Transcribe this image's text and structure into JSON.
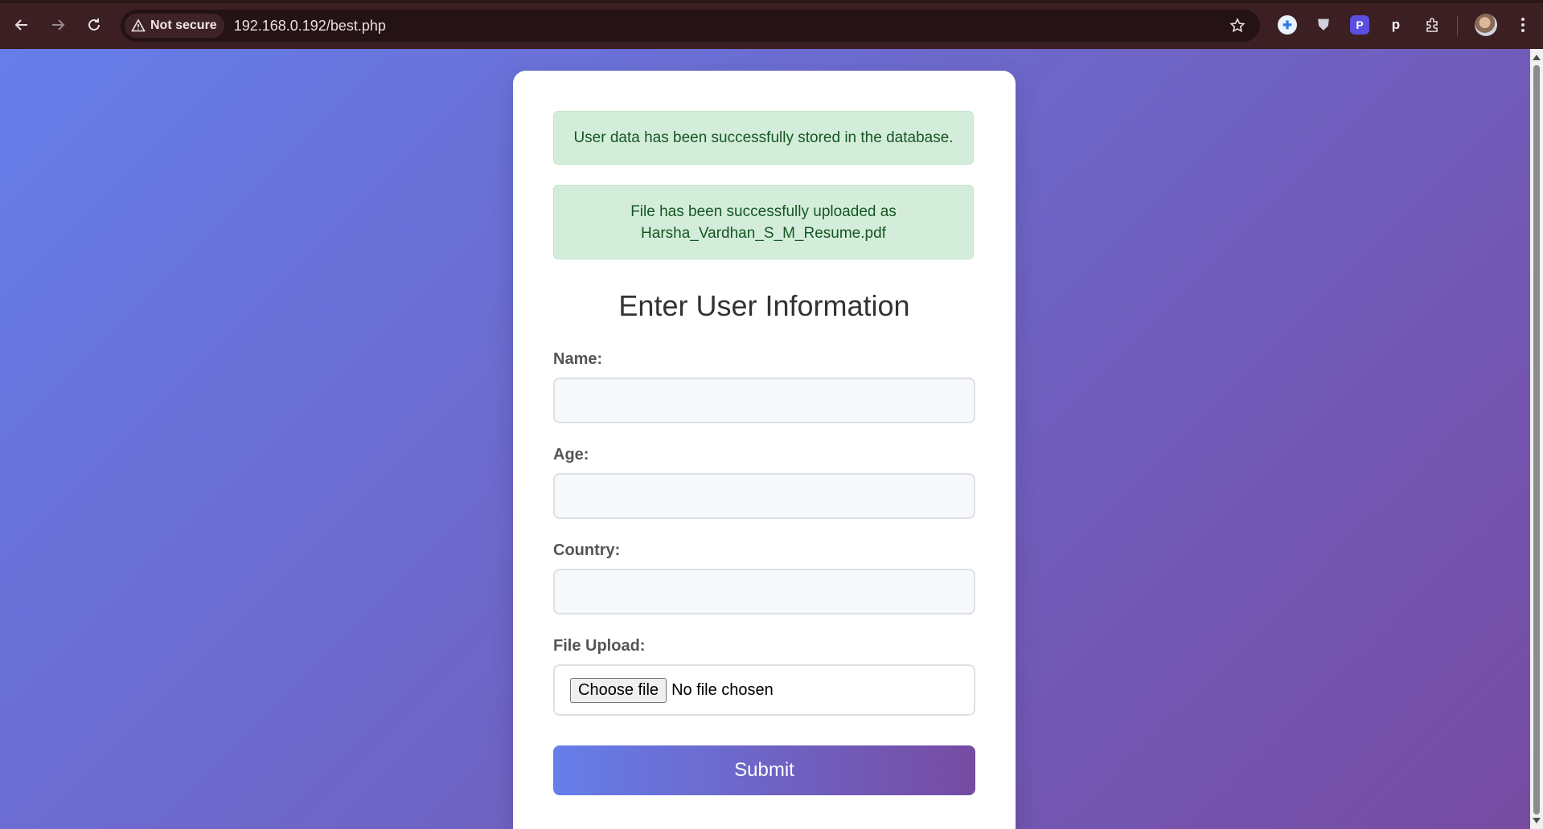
{
  "browser": {
    "security_label": "Not secure",
    "url": "192.168.0.192/best.php",
    "icons": [
      "back-arrow-icon",
      "forward-arrow-icon",
      "reload-icon",
      "warning-icon",
      "star-icon",
      "extension-puzzle-icon",
      "kebab-menu-icon"
    ],
    "extensions": [
      {
        "name": "extension-blue-cross",
        "glyph": "✚",
        "color": "#2d7be0"
      },
      {
        "name": "extension-shield",
        "glyph": "⛊",
        "color": "#c9c9d4"
      },
      {
        "name": "extension-purple-p",
        "glyph": "P",
        "color": "#5a4fe0"
      },
      {
        "name": "extension-p",
        "glyph": "p",
        "color": "#ffffff"
      }
    ]
  },
  "alerts": {
    "db_message": "User data has been successfully stored in the database.",
    "file_message": "File has been successfully uploaded as Harsha_Vardhan_S_M_Resume.pdf"
  },
  "form": {
    "title": "Enter User Information",
    "name_label": "Name:",
    "age_label": "Age:",
    "country_label": "Country:",
    "file_label": "File Upload:",
    "name_value": "",
    "age_value": "",
    "country_value": "",
    "choose_file_label": "Choose file",
    "file_status": "No file chosen",
    "submit_label": "Submit"
  },
  "colors": {
    "gradient_start": "#667eea",
    "gradient_end": "#764ba2",
    "alert_bg": "#d4edda",
    "alert_text": "#155724",
    "chrome_bg": "#3b1f22"
  }
}
